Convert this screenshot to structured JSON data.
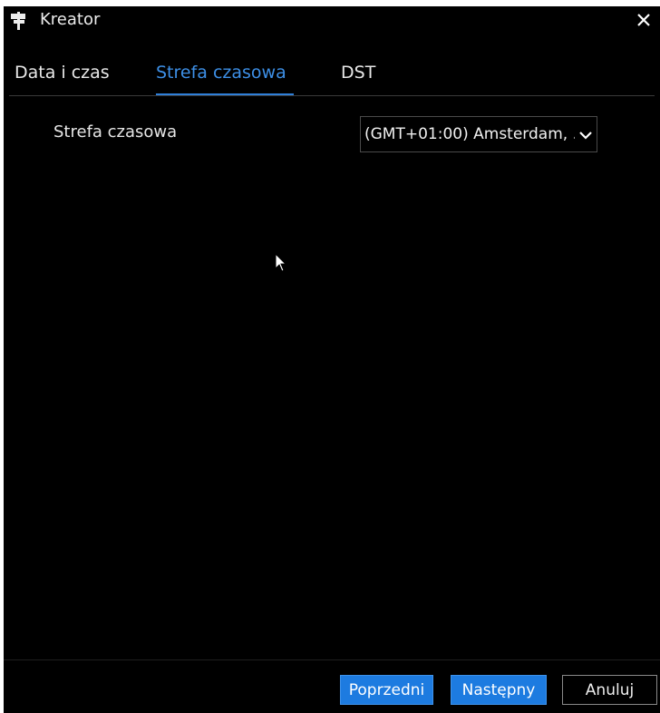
{
  "window": {
    "title": "Kreator",
    "icon": "signpost-icon",
    "close_icon": "close-icon"
  },
  "tabs": [
    {
      "label": "Data i czas",
      "active": false
    },
    {
      "label": "Strefa czasowa",
      "active": true
    },
    {
      "label": "DST",
      "active": false
    }
  ],
  "form": {
    "timezone_label": "Strefa czasowa",
    "timezone_value": "(GMT+01:00) Amsterdam, ."
  },
  "footer": {
    "prev_label": "Poprzedni",
    "next_label": "Następny",
    "cancel_label": "Anuluj"
  },
  "colors": {
    "accent": "#1d7be0",
    "active_tab": "#3d8fe6",
    "background": "#000000"
  }
}
